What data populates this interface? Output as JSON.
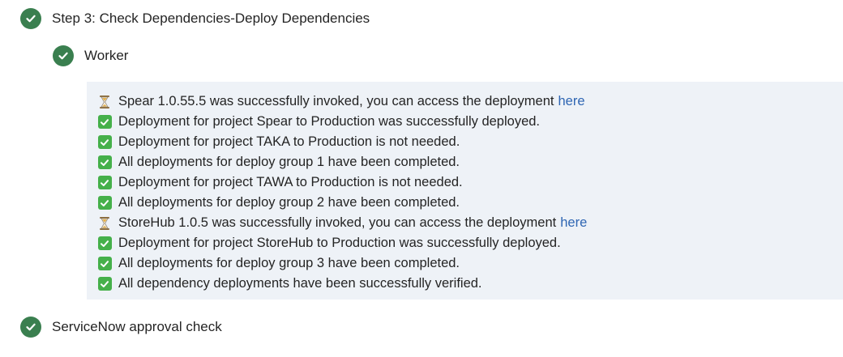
{
  "steps": {
    "step3": {
      "label": "Step 3: Check Dependencies-Deploy Dependencies",
      "status_icon": "check-circle-icon"
    },
    "worker": {
      "label": "Worker",
      "status_icon": "check-circle-icon"
    },
    "servicenow": {
      "label": "ServiceNow approval check",
      "status_icon": "check-circle-icon"
    }
  },
  "colors": {
    "success_circle": "#3a7f4f",
    "check_box": "#45b04a",
    "link": "#2f66b3",
    "log_background": "#eef2f7"
  },
  "log": {
    "lines": [
      {
        "icon": "hourglass-icon",
        "text": "Spear 1.0.55.5 was successfully invoked, you can access the deployment",
        "link": "here"
      },
      {
        "icon": "check-box-icon",
        "text": "Deployment for project Spear to Production was successfully deployed."
      },
      {
        "icon": "check-box-icon",
        "text": "Deployment for project TAKA to Production is not needed."
      },
      {
        "icon": "check-box-icon",
        "text": "All deployments for deploy group 1 have been completed."
      },
      {
        "icon": "check-box-icon",
        "text": "Deployment for project TAWA to Production is not needed."
      },
      {
        "icon": "check-box-icon",
        "text": "All deployments for deploy group 2 have been completed."
      },
      {
        "icon": "hourglass-icon",
        "text": "StoreHub 1.0.5 was successfully invoked, you can access the deployment",
        "link": "here"
      },
      {
        "icon": "check-box-icon",
        "text": "Deployment for project StoreHub to Production was successfully deployed."
      },
      {
        "icon": "check-box-icon",
        "text": "All deployments for deploy group 3 have been completed."
      },
      {
        "icon": "check-box-icon",
        "text": "All dependency deployments have been successfully verified."
      }
    ]
  }
}
